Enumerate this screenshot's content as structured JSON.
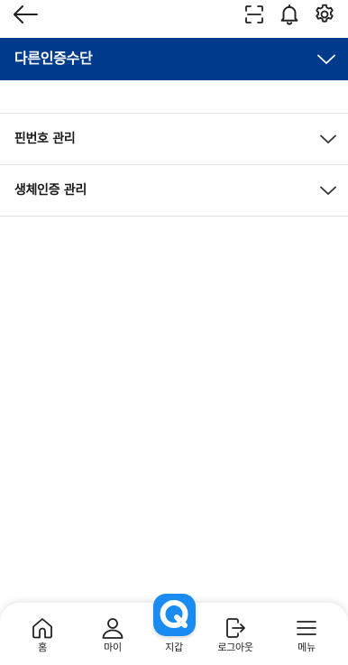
{
  "topbar": {
    "back_icon": "arrow-left-icon",
    "scan_icon": "scan-icon",
    "bell_icon": "bell-icon",
    "gear_icon": "gear-icon"
  },
  "section": {
    "title": "다른인증수단",
    "expanded_icon": "chevron-down-icon"
  },
  "accordion": {
    "items": [
      {
        "label": "핀번호 관리"
      },
      {
        "label": "생체인증 관리"
      }
    ]
  },
  "bottom_nav": {
    "items": [
      {
        "label": "홈",
        "icon": "home-icon"
      },
      {
        "label": "마이",
        "icon": "user-icon"
      },
      {
        "label": "지갑",
        "icon": "q-wallet-icon"
      },
      {
        "label": "로그아웃",
        "icon": "logout-icon"
      },
      {
        "label": "메뉴",
        "icon": "menu-icon"
      }
    ]
  },
  "colors": {
    "header_bg": "#003a8c",
    "wallet_accent": "#1a8bf0"
  }
}
